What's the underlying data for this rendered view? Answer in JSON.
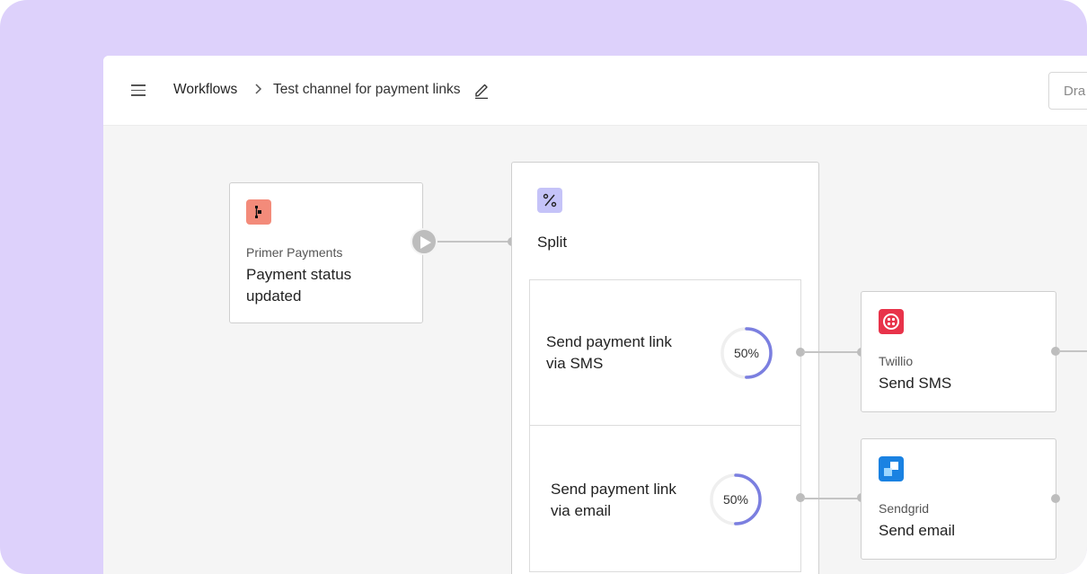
{
  "breadcrumb": {
    "root": "Workflows",
    "current": "Test channel for payment links"
  },
  "icons": {
    "menu": "hamburger-menu-icon",
    "separator": "chevron-right-icon",
    "edit": "pencil-icon",
    "play": "play-icon"
  },
  "status_button": {
    "label": "Dra"
  },
  "trigger": {
    "provider": "Primer Payments",
    "title_line1": "Payment status",
    "title_line2": "updated",
    "icon_color": "#f38b7a"
  },
  "split": {
    "label": "Split",
    "icon_color": "#c5c3f8",
    "branches": [
      {
        "line1": "Send payment link",
        "line2": "via SMS",
        "percent_label": "50%",
        "percent": 50
      },
      {
        "line1": "Send payment link",
        "line2": "via email",
        "percent_label": "50%",
        "percent": 50
      }
    ]
  },
  "actions": [
    {
      "provider": "Twillio",
      "title": "Send SMS",
      "icon_color": "#e8334a"
    },
    {
      "provider": "Sendgrid",
      "title": "Send email",
      "icon_color": "#1a82e2"
    }
  ],
  "colors": {
    "background": "#ddd1fb",
    "canvas": "#f5f5f5",
    "ring_accent": "#7b7fe0",
    "ring_track": "#efefef"
  }
}
